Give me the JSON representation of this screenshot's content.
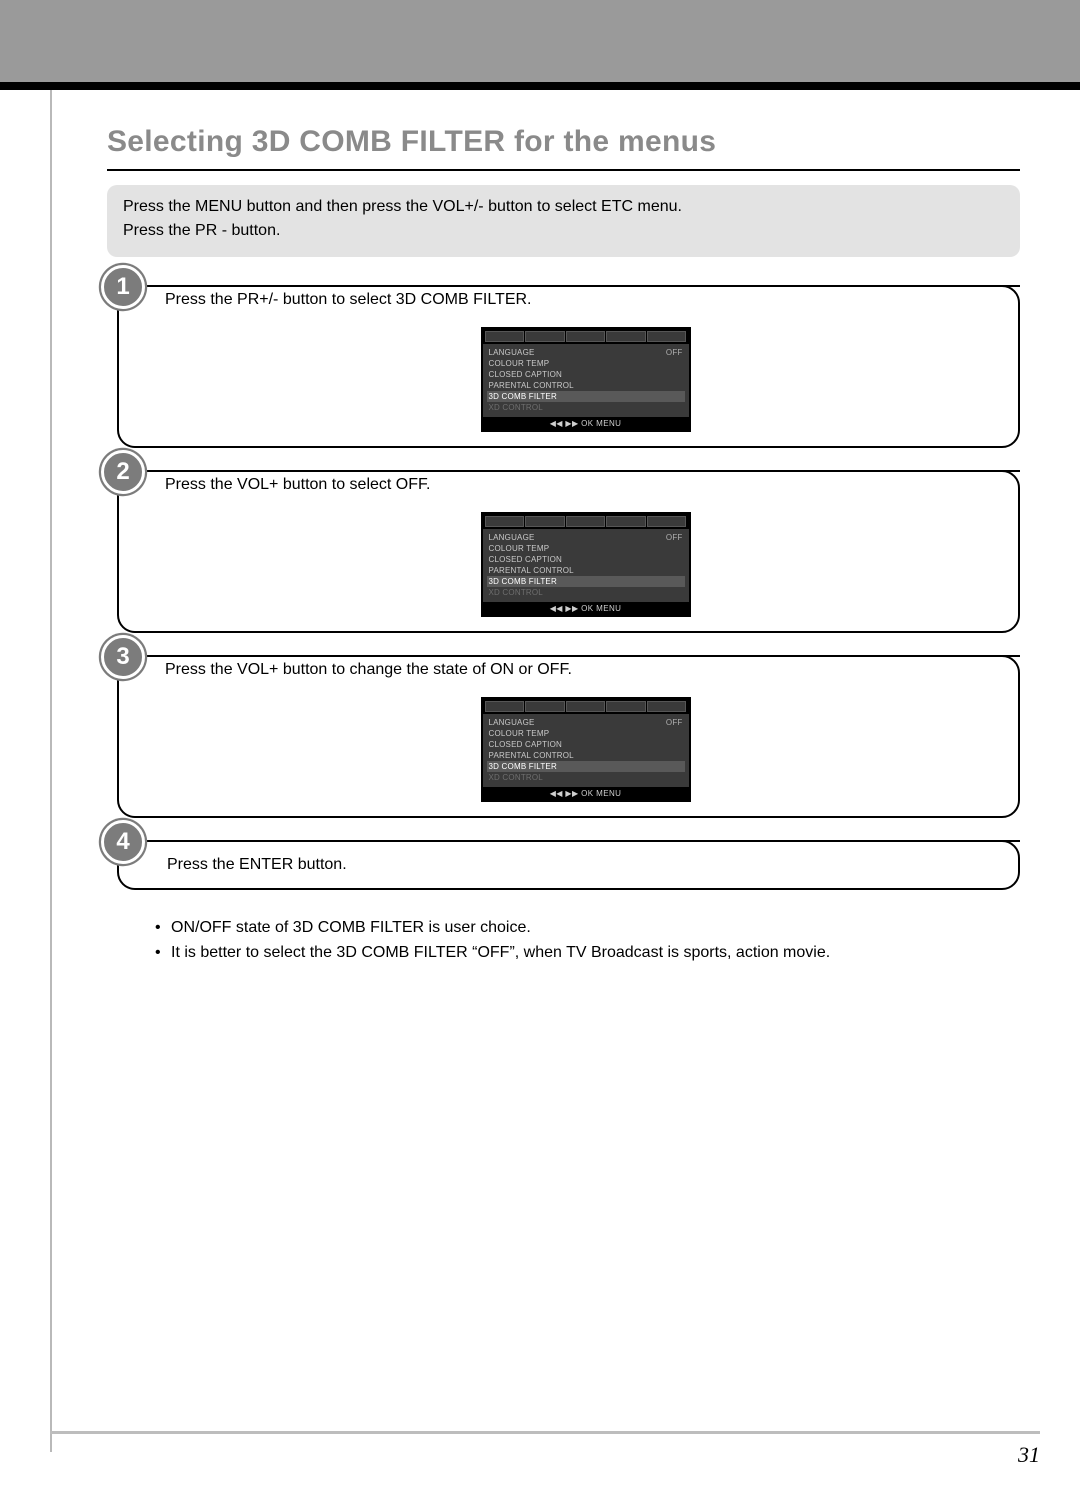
{
  "title": "Selecting 3D COMB FILTER for the menus",
  "intro": {
    "line1": "Press the MENU button and then press the VOL+/- button to select ETC menu.",
    "line2": "Press the PR - button."
  },
  "steps": [
    {
      "num": "1",
      "text": "Press the PR+/- button to select 3D COMB FILTER."
    },
    {
      "num": "2",
      "text": "Press the VOL+ button to select OFF."
    },
    {
      "num": "3",
      "text": "Press the VOL+ button to change the state of ON or OFF."
    },
    {
      "num": "4",
      "text": "Press the ENTER button."
    }
  ],
  "osd": {
    "rows": [
      {
        "label": "LANGUAGE",
        "right": "OFF"
      },
      {
        "label": "COLOUR TEMP",
        "right": ""
      },
      {
        "label": "CLOSED CAPTION",
        "right": ""
      },
      {
        "label": "PARENTAL CONTROL",
        "right": ""
      },
      {
        "label": "3D COMB FILTER",
        "right": ""
      },
      {
        "label": "XD CONTROL",
        "right": ""
      }
    ],
    "hint": "◀◀  ▶▶  OK  MENU"
  },
  "bullets": [
    "ON/OFF state of 3D COMB FILTER is user choice.",
    "It is better to select the 3D COMB FILTER “OFF”, when TV Broadcast is sports, action movie."
  ],
  "page_number": "31"
}
